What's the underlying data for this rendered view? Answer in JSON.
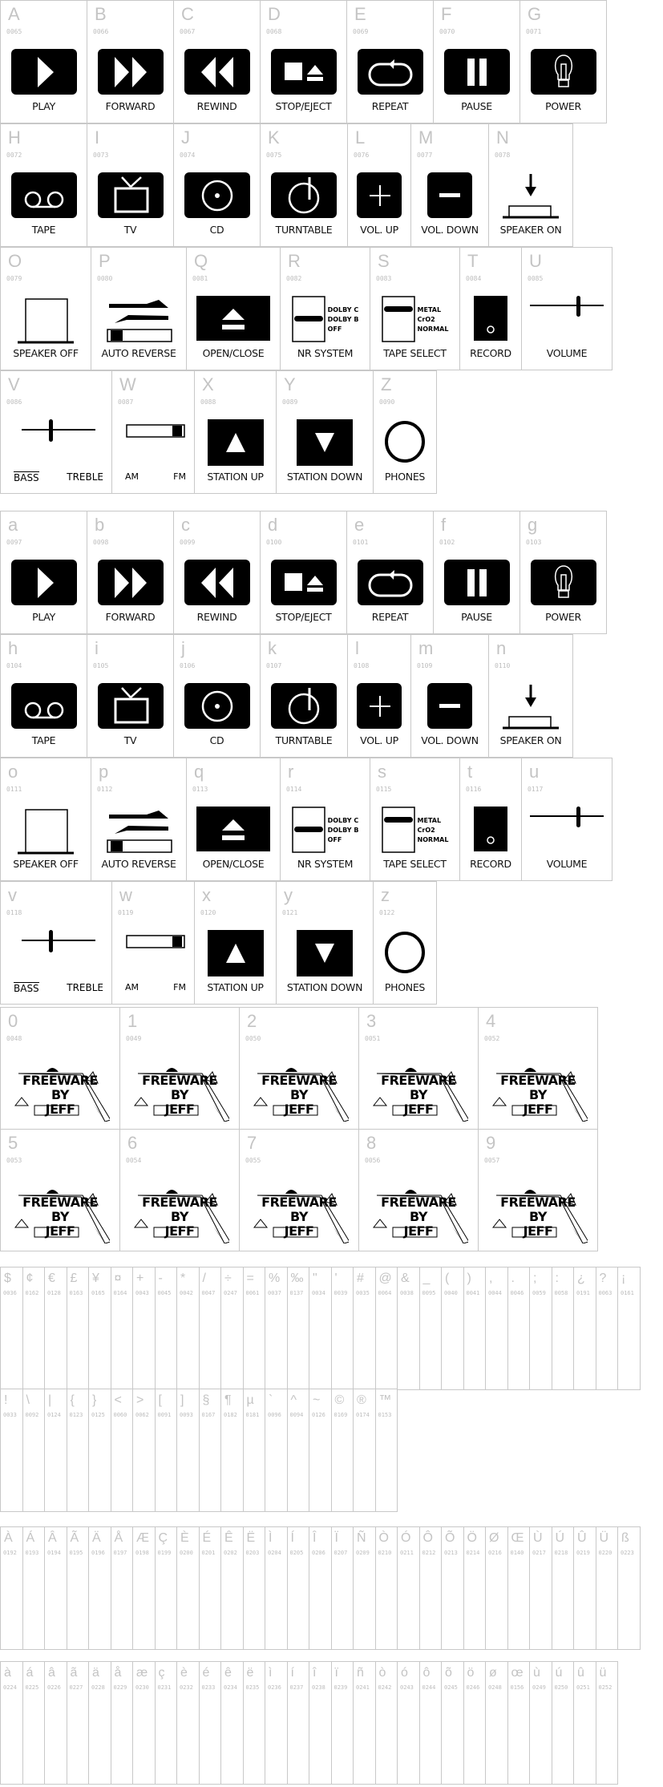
{
  "font_sample": {
    "uppercase": [
      [
        {
          "char": "A",
          "code": "0065",
          "label": "PLAY",
          "icon": "play-icon"
        },
        {
          "char": "B",
          "code": "0066",
          "label": "FORWARD",
          "icon": "fast-forward-icon"
        },
        {
          "char": "C",
          "code": "0067",
          "label": "REWIND",
          "icon": "rewind-icon"
        },
        {
          "char": "D",
          "code": "0068",
          "label": "STOP/EJECT",
          "icon": "stop-eject-icon"
        },
        {
          "char": "E",
          "code": "0069",
          "label": "REPEAT",
          "icon": "repeat-icon"
        },
        {
          "char": "F",
          "code": "0070",
          "label": "PAUSE",
          "icon": "pause-icon"
        },
        {
          "char": "G",
          "code": "0071",
          "label": "POWER",
          "icon": "lightbulb-icon"
        }
      ],
      [
        {
          "char": "H",
          "code": "0072",
          "label": "TAPE",
          "icon": "tape-icon"
        },
        {
          "char": "I",
          "code": "0073",
          "label": "TV",
          "icon": "tv-icon"
        },
        {
          "char": "J",
          "code": "0074",
          "label": "CD",
          "icon": "cd-icon"
        },
        {
          "char": "K",
          "code": "0075",
          "label": "TURNTABLE",
          "icon": "turntable-icon"
        },
        {
          "char": "L",
          "code": "0076",
          "label": "VOL. UP",
          "icon": "plus-icon"
        },
        {
          "char": "M",
          "code": "0077",
          "label": "VOL. DOWN",
          "icon": "minus-icon"
        },
        {
          "char": "N",
          "code": "0078",
          "label": "SPEAKER ON",
          "icon": "speaker-on-icon"
        }
      ],
      [
        {
          "char": "O",
          "code": "0079",
          "label": "SPEAKER OFF",
          "icon": "speaker-off-icon"
        },
        {
          "char": "P",
          "code": "0080",
          "label": "AUTO REVERSE",
          "icon": "auto-reverse-icon"
        },
        {
          "char": "Q",
          "code": "0081",
          "label": "OPEN/CLOSE",
          "icon": "eject-icon"
        },
        {
          "char": "R",
          "code": "0082",
          "label": "NR SYSTEM",
          "icon": "nr-switch-icon",
          "options": [
            "DOLBY C",
            "DOLBY B",
            "OFF"
          ]
        },
        {
          "char": "S",
          "code": "0083",
          "label": "TAPE SELECT",
          "icon": "tape-select-switch-icon",
          "options": [
            "METAL",
            "CrO2",
            "NORMAL"
          ]
        },
        {
          "char": "T",
          "code": "0084",
          "label": "RECORD",
          "icon": "record-icon"
        },
        {
          "char": "U",
          "code": "0085",
          "label": "VOLUME",
          "icon": "volume-slider-icon"
        }
      ],
      [
        {
          "char": "V",
          "code": "0086",
          "label": "",
          "icon": "tone-slider-icon",
          "left": "BASS",
          "right": "TREBLE"
        },
        {
          "char": "W",
          "code": "0087",
          "label": "",
          "icon": "band-switch-icon",
          "left": "AM",
          "right": "FM"
        },
        {
          "char": "X",
          "code": "0088",
          "label": "STATION UP",
          "icon": "up-triangle-icon"
        },
        {
          "char": "Y",
          "code": "0089",
          "label": "STATION DOWN",
          "icon": "down-triangle-icon"
        },
        {
          "char": "Z",
          "code": "0090",
          "label": "PHONES",
          "icon": "circle-icon"
        }
      ]
    ],
    "lowercase": [
      [
        {
          "char": "a",
          "code": "0097",
          "label": "PLAY",
          "icon": "play-icon"
        },
        {
          "char": "b",
          "code": "0098",
          "label": "FORWARD",
          "icon": "fast-forward-icon"
        },
        {
          "char": "c",
          "code": "0099",
          "label": "REWIND",
          "icon": "rewind-icon"
        },
        {
          "char": "d",
          "code": "0100",
          "label": "STOP/EJECT",
          "icon": "stop-eject-icon"
        },
        {
          "char": "e",
          "code": "0101",
          "label": "REPEAT",
          "icon": "repeat-icon"
        },
        {
          "char": "f",
          "code": "0102",
          "label": "PAUSE",
          "icon": "pause-icon"
        },
        {
          "char": "g",
          "code": "0103",
          "label": "POWER",
          "icon": "lightbulb-icon"
        }
      ],
      [
        {
          "char": "h",
          "code": "0104",
          "label": "TAPE",
          "icon": "tape-icon"
        },
        {
          "char": "i",
          "code": "0105",
          "label": "TV",
          "icon": "tv-icon"
        },
        {
          "char": "j",
          "code": "0106",
          "label": "CD",
          "icon": "cd-icon"
        },
        {
          "char": "k",
          "code": "0107",
          "label": "TURNTABLE",
          "icon": "turntable-icon"
        },
        {
          "char": "l",
          "code": "0108",
          "label": "VOL. UP",
          "icon": "plus-icon"
        },
        {
          "char": "m",
          "code": "0109",
          "label": "VOL. DOWN",
          "icon": "minus-icon"
        },
        {
          "char": "n",
          "code": "0110",
          "label": "SPEAKER ON",
          "icon": "speaker-on-icon"
        }
      ],
      [
        {
          "char": "o",
          "code": "0111",
          "label": "SPEAKER OFF",
          "icon": "speaker-off-icon"
        },
        {
          "char": "p",
          "code": "0112",
          "label": "AUTO REVERSE",
          "icon": "auto-reverse-icon"
        },
        {
          "char": "q",
          "code": "0113",
          "label": "OPEN/CLOSE",
          "icon": "eject-icon"
        },
        {
          "char": "r",
          "code": "0114",
          "label": "NR SYSTEM",
          "icon": "nr-switch-icon",
          "options": [
            "DOLBY C",
            "DOLBY B",
            "OFF"
          ]
        },
        {
          "char": "s",
          "code": "0115",
          "label": "TAPE SELECT",
          "icon": "tape-select-switch-icon",
          "options": [
            "METAL",
            "CrO2",
            "NORMAL"
          ]
        },
        {
          "char": "t",
          "code": "0116",
          "label": "RECORD",
          "icon": "record-icon"
        },
        {
          "char": "u",
          "code": "0117",
          "label": "VOLUME",
          "icon": "volume-slider-icon"
        }
      ],
      [
        {
          "char": "v",
          "code": "0118",
          "label": "",
          "icon": "tone-slider-icon",
          "left": "BASS",
          "right": "TREBLE"
        },
        {
          "char": "w",
          "code": "0119",
          "label": "",
          "icon": "band-switch-icon",
          "left": "AM",
          "right": "FM"
        },
        {
          "char": "x",
          "code": "0120",
          "label": "STATION UP",
          "icon": "up-triangle-icon"
        },
        {
          "char": "y",
          "code": "0121",
          "label": "STATION DOWN",
          "icon": "down-triangle-icon"
        },
        {
          "char": "z",
          "code": "0122",
          "label": "PHONES",
          "icon": "circle-icon"
        }
      ]
    ],
    "digits": {
      "logo_text": [
        "FREEWARE",
        "BY",
        "JEFF"
      ],
      "rows": [
        [
          {
            "char": "0",
            "code": "0048"
          },
          {
            "char": "1",
            "code": "0049"
          },
          {
            "char": "2",
            "code": "0050"
          },
          {
            "char": "3",
            "code": "0051"
          },
          {
            "char": "4",
            "code": "0052"
          }
        ],
        [
          {
            "char": "5",
            "code": "0053"
          },
          {
            "char": "6",
            "code": "0054"
          },
          {
            "char": "7",
            "code": "0055"
          },
          {
            "char": "8",
            "code": "0056"
          },
          {
            "char": "9",
            "code": "0057"
          }
        ]
      ]
    },
    "symbols": [
      [
        {
          "char": "$",
          "code": "0036"
        },
        {
          "char": "¢",
          "code": "0162"
        },
        {
          "char": "€",
          "code": "0128"
        },
        {
          "char": "£",
          "code": "0163"
        },
        {
          "char": "¥",
          "code": "0165"
        },
        {
          "char": "¤",
          "code": "0164"
        },
        {
          "char": "+",
          "code": "0043"
        },
        {
          "char": "-",
          "code": "0045"
        },
        {
          "char": "*",
          "code": "0042"
        },
        {
          "char": "/",
          "code": "0047"
        },
        {
          "char": "÷",
          "code": "0247"
        },
        {
          "char": "=",
          "code": "0061"
        },
        {
          "char": "%",
          "code": "0037"
        },
        {
          "char": "‰",
          "code": "0137"
        },
        {
          "char": "\"",
          "code": "0034"
        },
        {
          "char": "'",
          "code": "0039"
        },
        {
          "char": "#",
          "code": "0035"
        },
        {
          "char": "@",
          "code": "0064"
        },
        {
          "char": "&",
          "code": "0038"
        },
        {
          "char": "_",
          "code": "0095"
        },
        {
          "char": "(",
          "code": "0040"
        },
        {
          "char": ")",
          "code": "0041"
        },
        {
          "char": ",",
          "code": "0044"
        },
        {
          "char": ".",
          "code": "0046"
        },
        {
          "char": ";",
          "code": "0059"
        },
        {
          "char": ":",
          "code": "0058"
        },
        {
          "char": "¿",
          "code": "0191"
        },
        {
          "char": "?",
          "code": "0063"
        },
        {
          "char": "¡",
          "code": "0161"
        }
      ],
      [
        {
          "char": "!",
          "code": "0033"
        },
        {
          "char": "\\",
          "code": "0092"
        },
        {
          "char": "|",
          "code": "0124"
        },
        {
          "char": "{",
          "code": "0123"
        },
        {
          "char": "}",
          "code": "0125"
        },
        {
          "char": "<",
          "code": "0060"
        },
        {
          "char": ">",
          "code": "0062"
        },
        {
          "char": "[",
          "code": "0091"
        },
        {
          "char": "]",
          "code": "0093"
        },
        {
          "char": "§",
          "code": "0167"
        },
        {
          "char": "¶",
          "code": "0182"
        },
        {
          "char": "µ",
          "code": "0181"
        },
        {
          "char": "`",
          "code": "0096"
        },
        {
          "char": "^",
          "code": "0094"
        },
        {
          "char": "~",
          "code": "0126"
        },
        {
          "char": "©",
          "code": "0169"
        },
        {
          "char": "®",
          "code": "0174"
        },
        {
          "char": "™",
          "code": "0153"
        }
      ]
    ],
    "accented_upper": [
      {
        "char": "À",
        "code": "0192"
      },
      {
        "char": "Á",
        "code": "0193"
      },
      {
        "char": "Â",
        "code": "0194"
      },
      {
        "char": "Ã",
        "code": "0195"
      },
      {
        "char": "Ä",
        "code": "0196"
      },
      {
        "char": "Å",
        "code": "0197"
      },
      {
        "char": "Æ",
        "code": "0198"
      },
      {
        "char": "Ç",
        "code": "0199"
      },
      {
        "char": "È",
        "code": "0200"
      },
      {
        "char": "É",
        "code": "0201"
      },
      {
        "char": "Ê",
        "code": "0202"
      },
      {
        "char": "Ë",
        "code": "0203"
      },
      {
        "char": "Ì",
        "code": "0204"
      },
      {
        "char": "Í",
        "code": "0205"
      },
      {
        "char": "Î",
        "code": "0206"
      },
      {
        "char": "Ï",
        "code": "0207"
      },
      {
        "char": "Ñ",
        "code": "0209"
      },
      {
        "char": "Ò",
        "code": "0210"
      },
      {
        "char": "Ó",
        "code": "0211"
      },
      {
        "char": "Ô",
        "code": "0212"
      },
      {
        "char": "Õ",
        "code": "0213"
      },
      {
        "char": "Ö",
        "code": "0214"
      },
      {
        "char": "Ø",
        "code": "0216"
      },
      {
        "char": "Œ",
        "code": "0140"
      },
      {
        "char": "Ù",
        "code": "0217"
      },
      {
        "char": "Ú",
        "code": "0218"
      },
      {
        "char": "Û",
        "code": "0219"
      },
      {
        "char": "Ü",
        "code": "0220"
      },
      {
        "char": "ß",
        "code": "0223"
      }
    ],
    "accented_lower": [
      {
        "char": "à",
        "code": "0224"
      },
      {
        "char": "á",
        "code": "0225"
      },
      {
        "char": "â",
        "code": "0226"
      },
      {
        "char": "ã",
        "code": "0227"
      },
      {
        "char": "ä",
        "code": "0228"
      },
      {
        "char": "å",
        "code": "0229"
      },
      {
        "char": "æ",
        "code": "0230"
      },
      {
        "char": "ç",
        "code": "0231"
      },
      {
        "char": "è",
        "code": "0232"
      },
      {
        "char": "é",
        "code": "0233"
      },
      {
        "char": "ê",
        "code": "0234"
      },
      {
        "char": "ë",
        "code": "0235"
      },
      {
        "char": "ì",
        "code": "0236"
      },
      {
        "char": "í",
        "code": "0237"
      },
      {
        "char": "î",
        "code": "0238"
      },
      {
        "char": "ï",
        "code": "0239"
      },
      {
        "char": "ñ",
        "code": "0241"
      },
      {
        "char": "ò",
        "code": "0242"
      },
      {
        "char": "ó",
        "code": "0243"
      },
      {
        "char": "ô",
        "code": "0244"
      },
      {
        "char": "õ",
        "code": "0245"
      },
      {
        "char": "ö",
        "code": "0246"
      },
      {
        "char": "ø",
        "code": "0248"
      },
      {
        "char": "œ",
        "code": "0156"
      },
      {
        "char": "ù",
        "code": "0249"
      },
      {
        "char": "ú",
        "code": "0250"
      },
      {
        "char": "û",
        "code": "0251"
      },
      {
        "char": "ü",
        "code": "0252"
      }
    ]
  }
}
